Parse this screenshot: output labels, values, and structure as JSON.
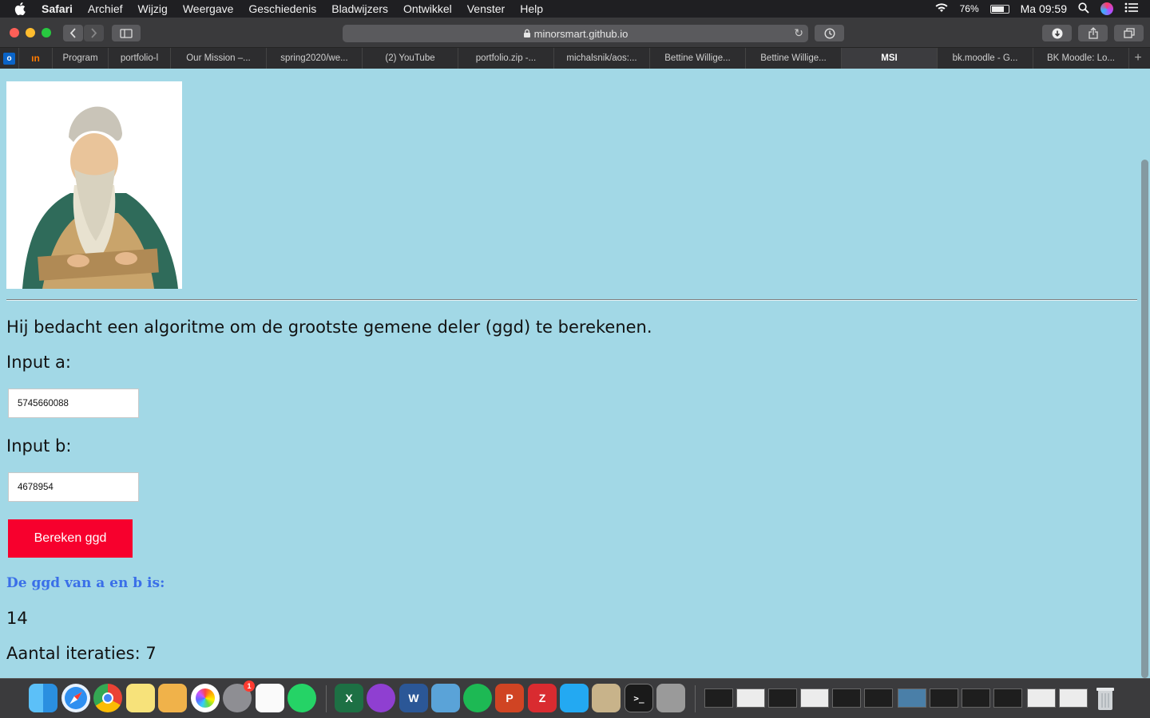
{
  "menubar": {
    "app_name": "Safari",
    "items": [
      "Archief",
      "Wijzig",
      "Weergave",
      "Geschiedenis",
      "Bladwijzers",
      "Ontwikkel",
      "Venster",
      "Help"
    ],
    "battery": "76%",
    "clock": "Ma 09:59"
  },
  "toolbar": {
    "url": "minorsmart.github.io"
  },
  "tabs": [
    {
      "label": "Program"
    },
    {
      "label": "portfolio-l"
    },
    {
      "label": "Our Mission –..."
    },
    {
      "label": "spring2020/we..."
    },
    {
      "label": "(2) YouTube"
    },
    {
      "label": "portfolio.zip -..."
    },
    {
      "label": "michalsnik/aos:..."
    },
    {
      "label": "Bettine Willige..."
    },
    {
      "label": "Bettine Willige..."
    },
    {
      "label": "MSI"
    },
    {
      "label": "bk.moodle - G..."
    },
    {
      "label": "BK Moodle: Lo..."
    }
  ],
  "page": {
    "intro": "Hij bedacht een algoritme om de grootste gemene deler (ggd) te berekenen.",
    "input_a_label": "Input a:",
    "input_a_value": "5745660088",
    "input_b_label": "Input b:",
    "input_b_value": "4678954",
    "button_label": "Bereken ggd",
    "result_title": "De ggd van a en b is:",
    "result_value": "14",
    "iterations": "Aantal iteraties: 7"
  },
  "dock": {
    "badge_count": "1",
    "excel_letter": "X",
    "word_letter": "W",
    "powerpoint_letter": "P",
    "zotero_letter": "Z"
  }
}
